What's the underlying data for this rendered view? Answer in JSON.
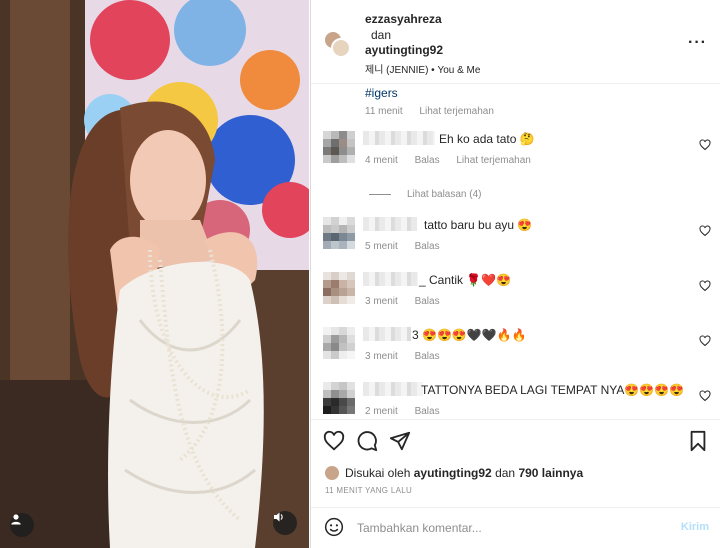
{
  "header": {
    "user1": "ezzasyahreza",
    "and_text": "dan",
    "user2": "ayutingting92",
    "audio": "제니 (JENNIE) • You & Me",
    "more_icon": "more-horizontal-icon"
  },
  "caption": {
    "hashtag": "#igers",
    "time": "11 menit",
    "translate": "Lihat terjemahan"
  },
  "comments": [
    {
      "text": "Eh ko ada tato 🤔",
      "meta": [
        "4 menit",
        "Balas",
        "Lihat terjemahan"
      ]
    },
    {
      "text": "tatto baru bu ayu 😍",
      "meta": [
        "5 menit",
        "Balas"
      ]
    },
    {
      "text": "_ Cantik 🌹❤️😍",
      "meta": [
        "3 menit",
        "Balas"
      ]
    },
    {
      "text": "3 😍😍😍🖤🖤🔥🔥",
      "meta": [
        "3 menit",
        "Balas"
      ]
    },
    {
      "text": "TATTONYA BEDA LAGI TEMPAT NYA😍😍😍😍",
      "meta": [
        "2 menit",
        "Balas"
      ]
    }
  ],
  "replies_label": "Lihat balasan (4)",
  "likes": {
    "prefix": "Disukai oleh",
    "user": "ayutingting92",
    "middle": "dan",
    "count": "790 lainnya"
  },
  "timestamp": "11 MENIT YANG LALU",
  "composer": {
    "placeholder": "Tambahkan komentar...",
    "post_label": "Kirim"
  },
  "colors": {
    "link": "#00376b",
    "muted": "#8e8e8e",
    "post_disabled": "#b2dffc"
  }
}
